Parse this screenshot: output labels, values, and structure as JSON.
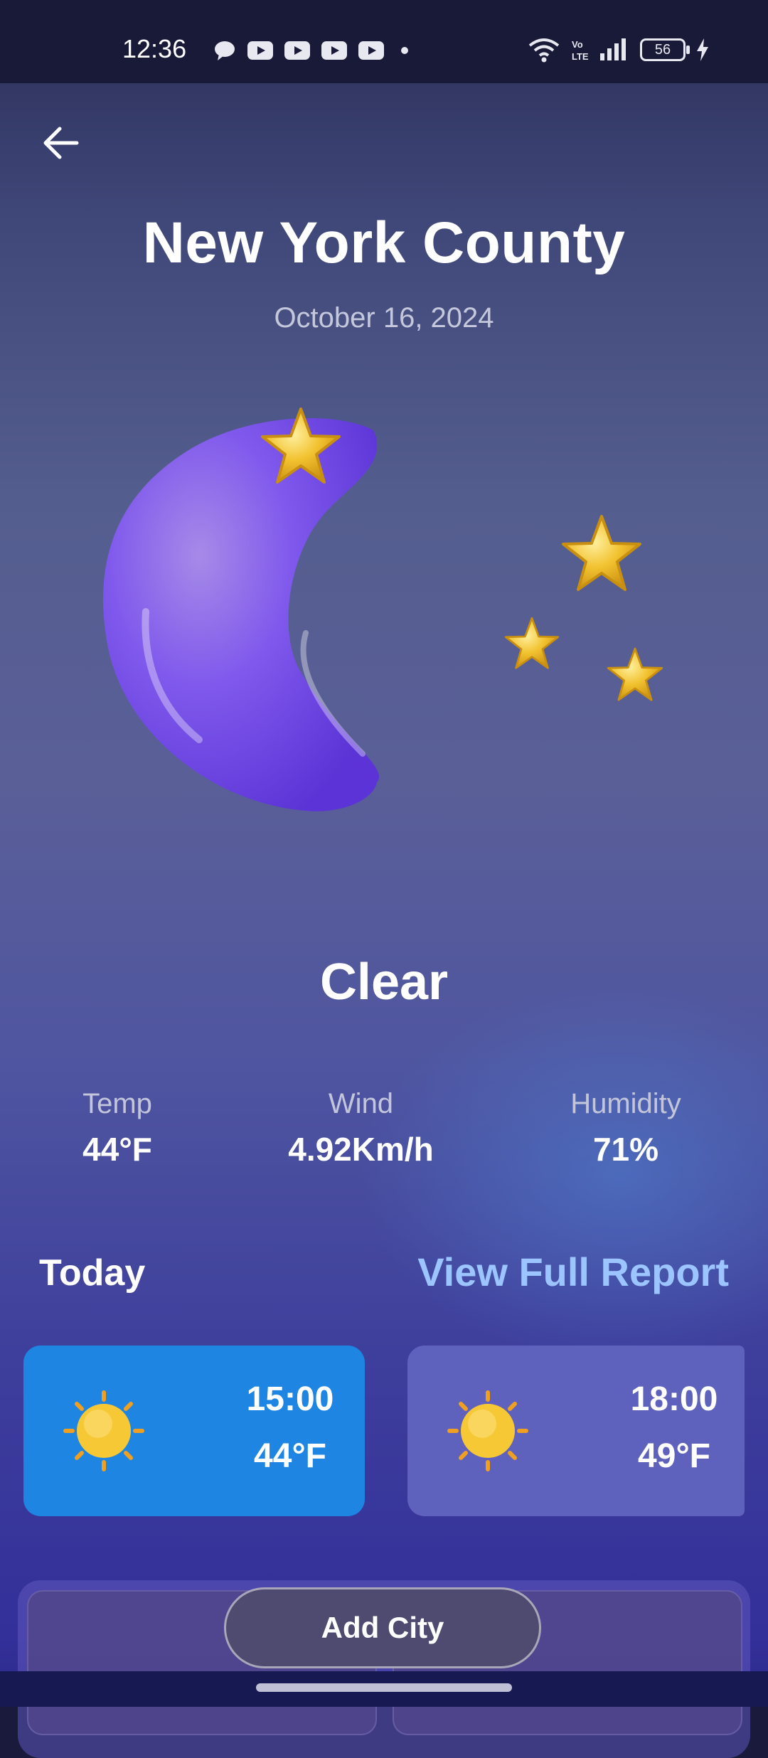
{
  "status_bar": {
    "time": "12:36",
    "battery": "56",
    "network_label": "Vo LTE"
  },
  "header": {
    "city": "New York County",
    "date": "October 16, 2024"
  },
  "weather": {
    "condition": "Clear",
    "hero_icon": "crescent-moon-with-stars",
    "stats": [
      {
        "label": "Temp",
        "value": "44°F"
      },
      {
        "label": "Wind",
        "value": "4.92Km/h"
      },
      {
        "label": "Humidity",
        "value": "71%"
      }
    ]
  },
  "today": {
    "label": "Today",
    "report_link": "View Full Report",
    "hours": [
      {
        "time": "15:00",
        "temp": "44°F",
        "icon": "sun-icon"
      },
      {
        "time": "18:00",
        "temp": "49°F",
        "icon": "sun-icon"
      }
    ]
  },
  "bottom": {
    "add_city_label": "Add City"
  },
  "colors": {
    "accent_link": "#9cc4ff",
    "active_card": "#1f85e3",
    "inactive_card": "#5f62bd",
    "moon": "#7b55ea",
    "star": "#f2c230"
  }
}
